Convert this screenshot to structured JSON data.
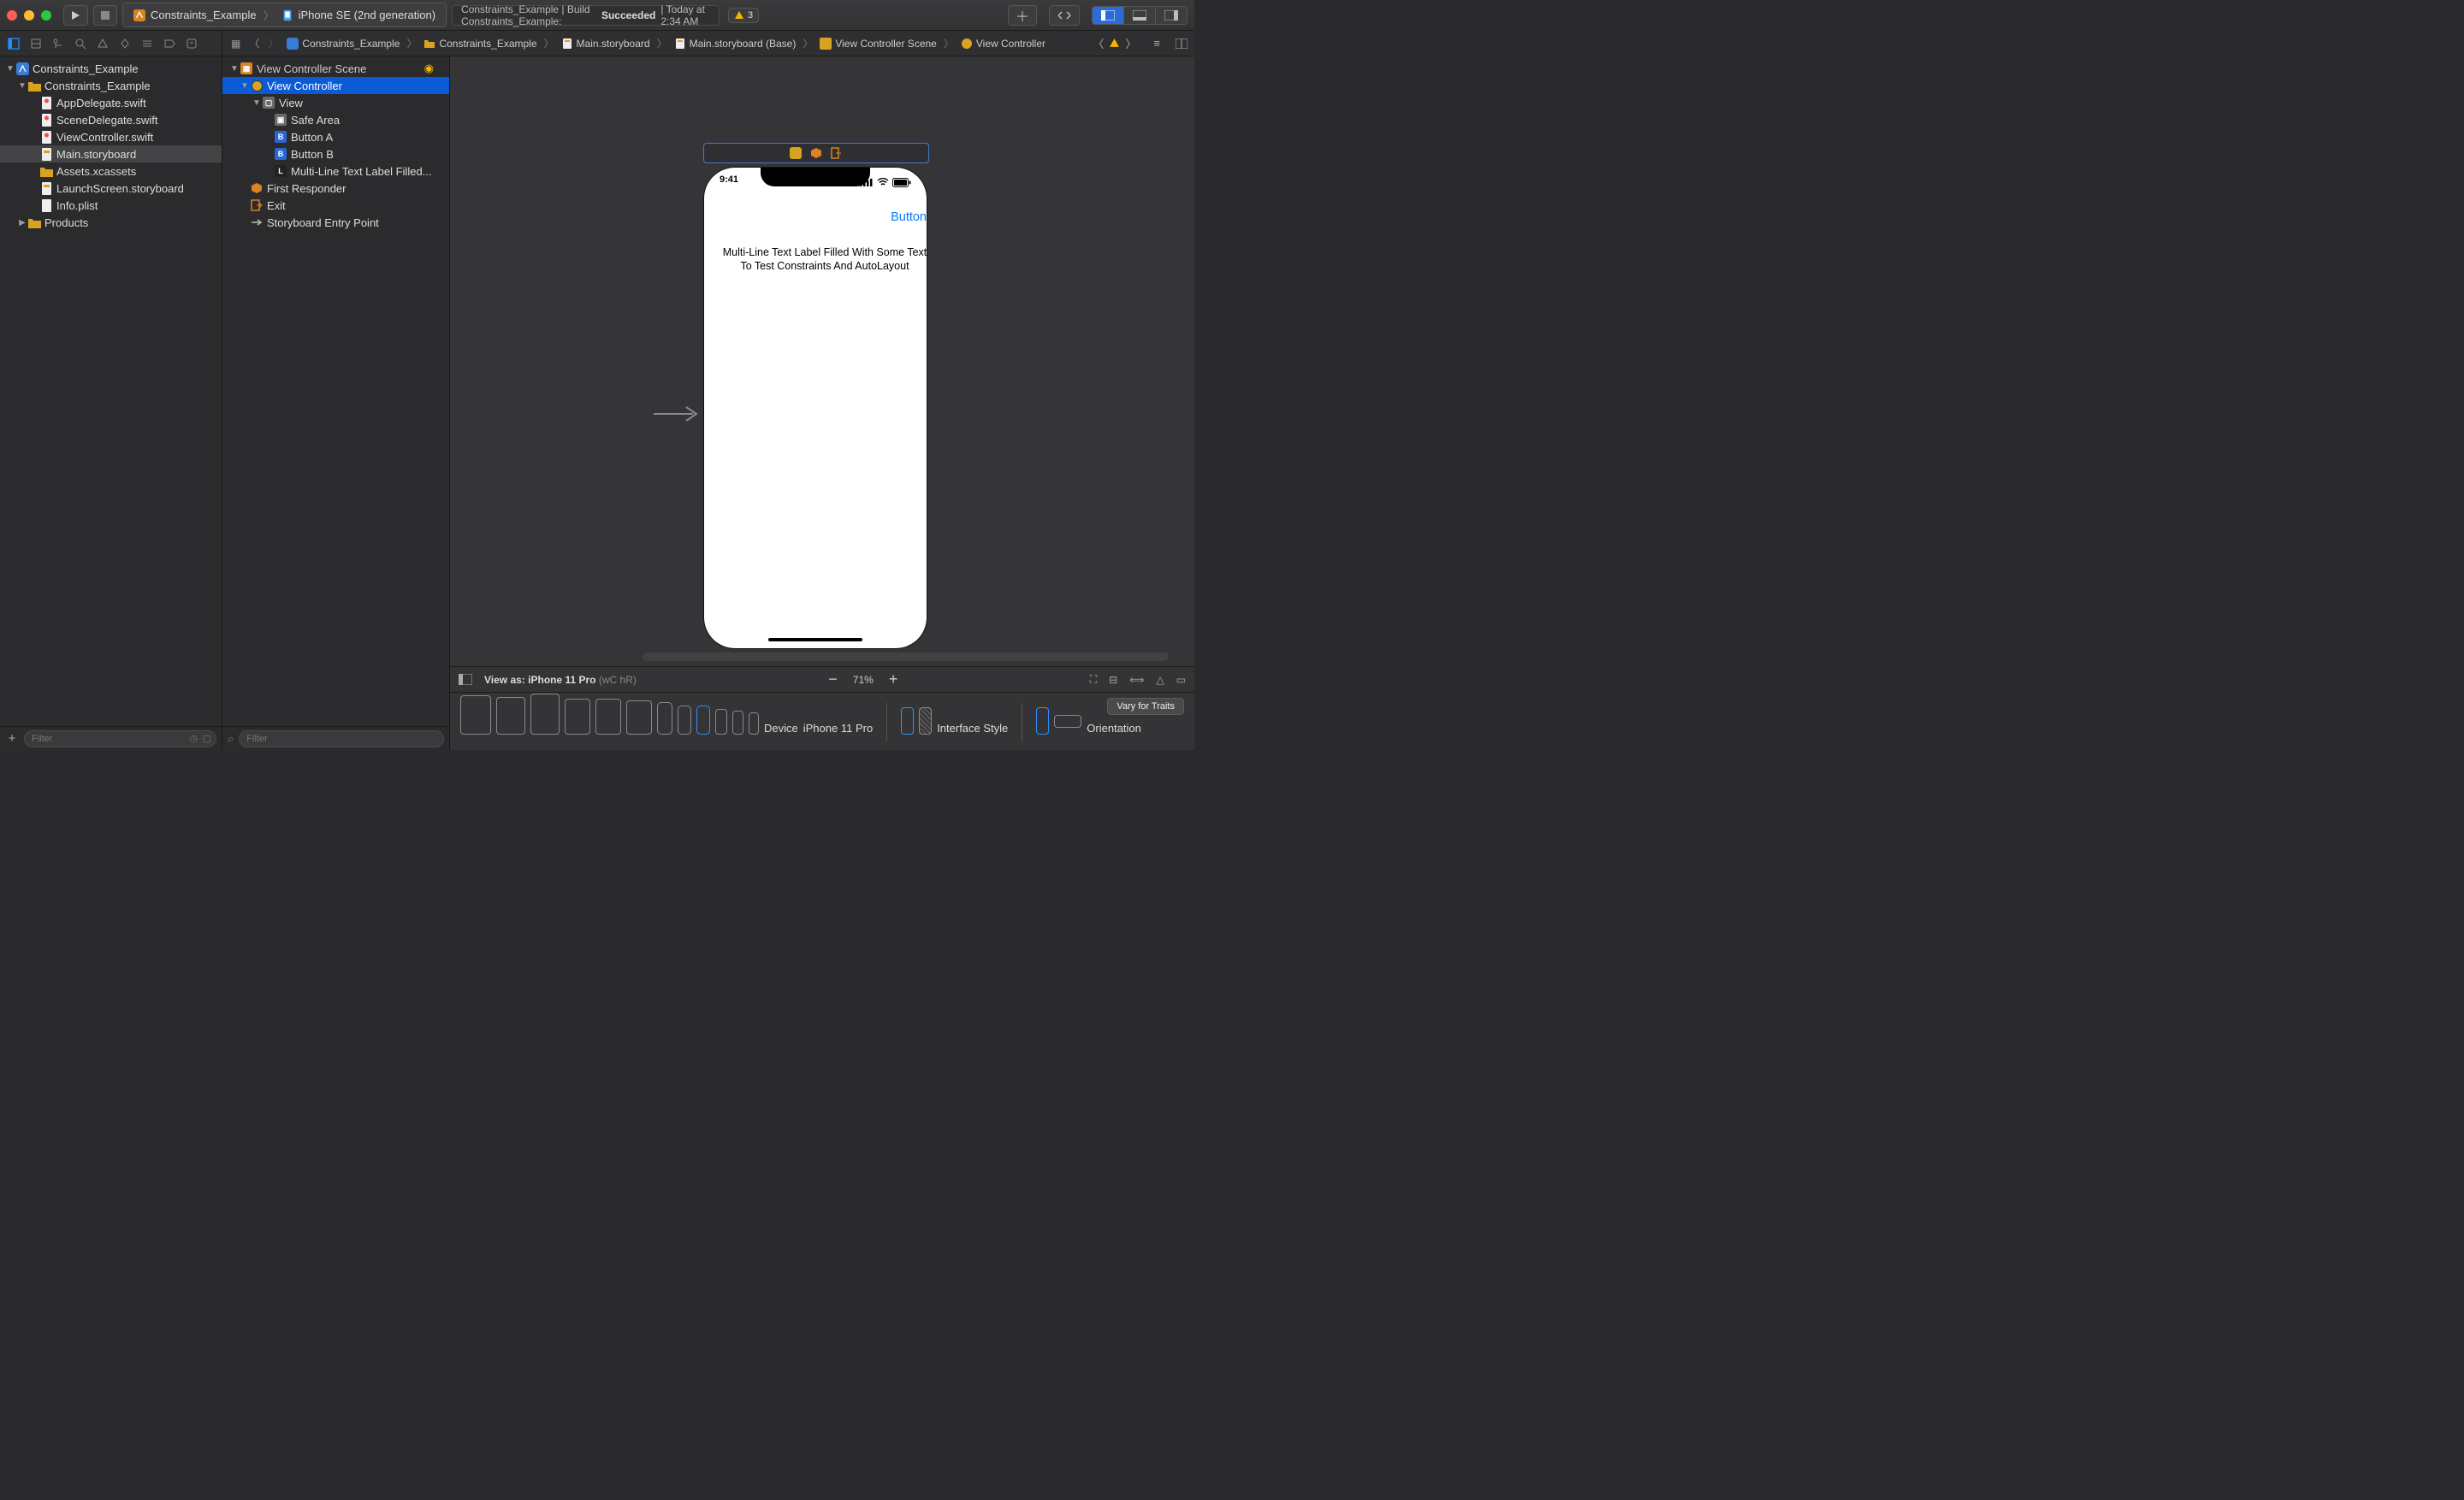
{
  "titlebar": {
    "scheme": "Constraints_Example",
    "destination": "iPhone SE (2nd generation)",
    "activity_prefix": "Constraints_Example | Build Constraints_Example:",
    "activity_status": "Succeeded",
    "activity_suffix": "| Today at 2:34 AM",
    "warn_count": "3"
  },
  "jump": {
    "crumbs": [
      "Constraints_Example",
      "Constraints_Example",
      "Main.storyboard",
      "Main.storyboard (Base)",
      "View Controller Scene",
      "View Controller"
    ]
  },
  "project_tree": {
    "root": "Constraints_Example",
    "group": "Constraints_Example",
    "files": [
      "AppDelegate.swift",
      "SceneDelegate.swift",
      "ViewController.swift",
      "Main.storyboard",
      "Assets.xcassets",
      "LaunchScreen.storyboard",
      "Info.plist"
    ],
    "products": "Products",
    "filter_placeholder": "Filter"
  },
  "outline": {
    "scene": "View Controller Scene",
    "vc": "View Controller",
    "view": "View",
    "safe": "Safe Area",
    "btnA": "Button A",
    "btnB": "Button B",
    "mlabel": "Multi-Line Text Label Filled...",
    "first": "First Responder",
    "exit": "Exit",
    "entry": "Storyboard Entry Point",
    "filter_placeholder": "Filter"
  },
  "canvas": {
    "time": "9:41",
    "button_label": "Button",
    "ml_text": "Multi-Line Text Label Filled With Some Text To Test Constraints And AutoLayout"
  },
  "viewas": {
    "prefix": "View as:",
    "device": "iPhone 11 Pro",
    "size_class": "(wC hR)",
    "zoom": "71%"
  },
  "devbar": {
    "device_label": "Device",
    "selected_label": "iPhone 11 Pro",
    "style_label": "Interface Style",
    "orient_label": "Orientation",
    "vary": "Vary for Traits"
  }
}
